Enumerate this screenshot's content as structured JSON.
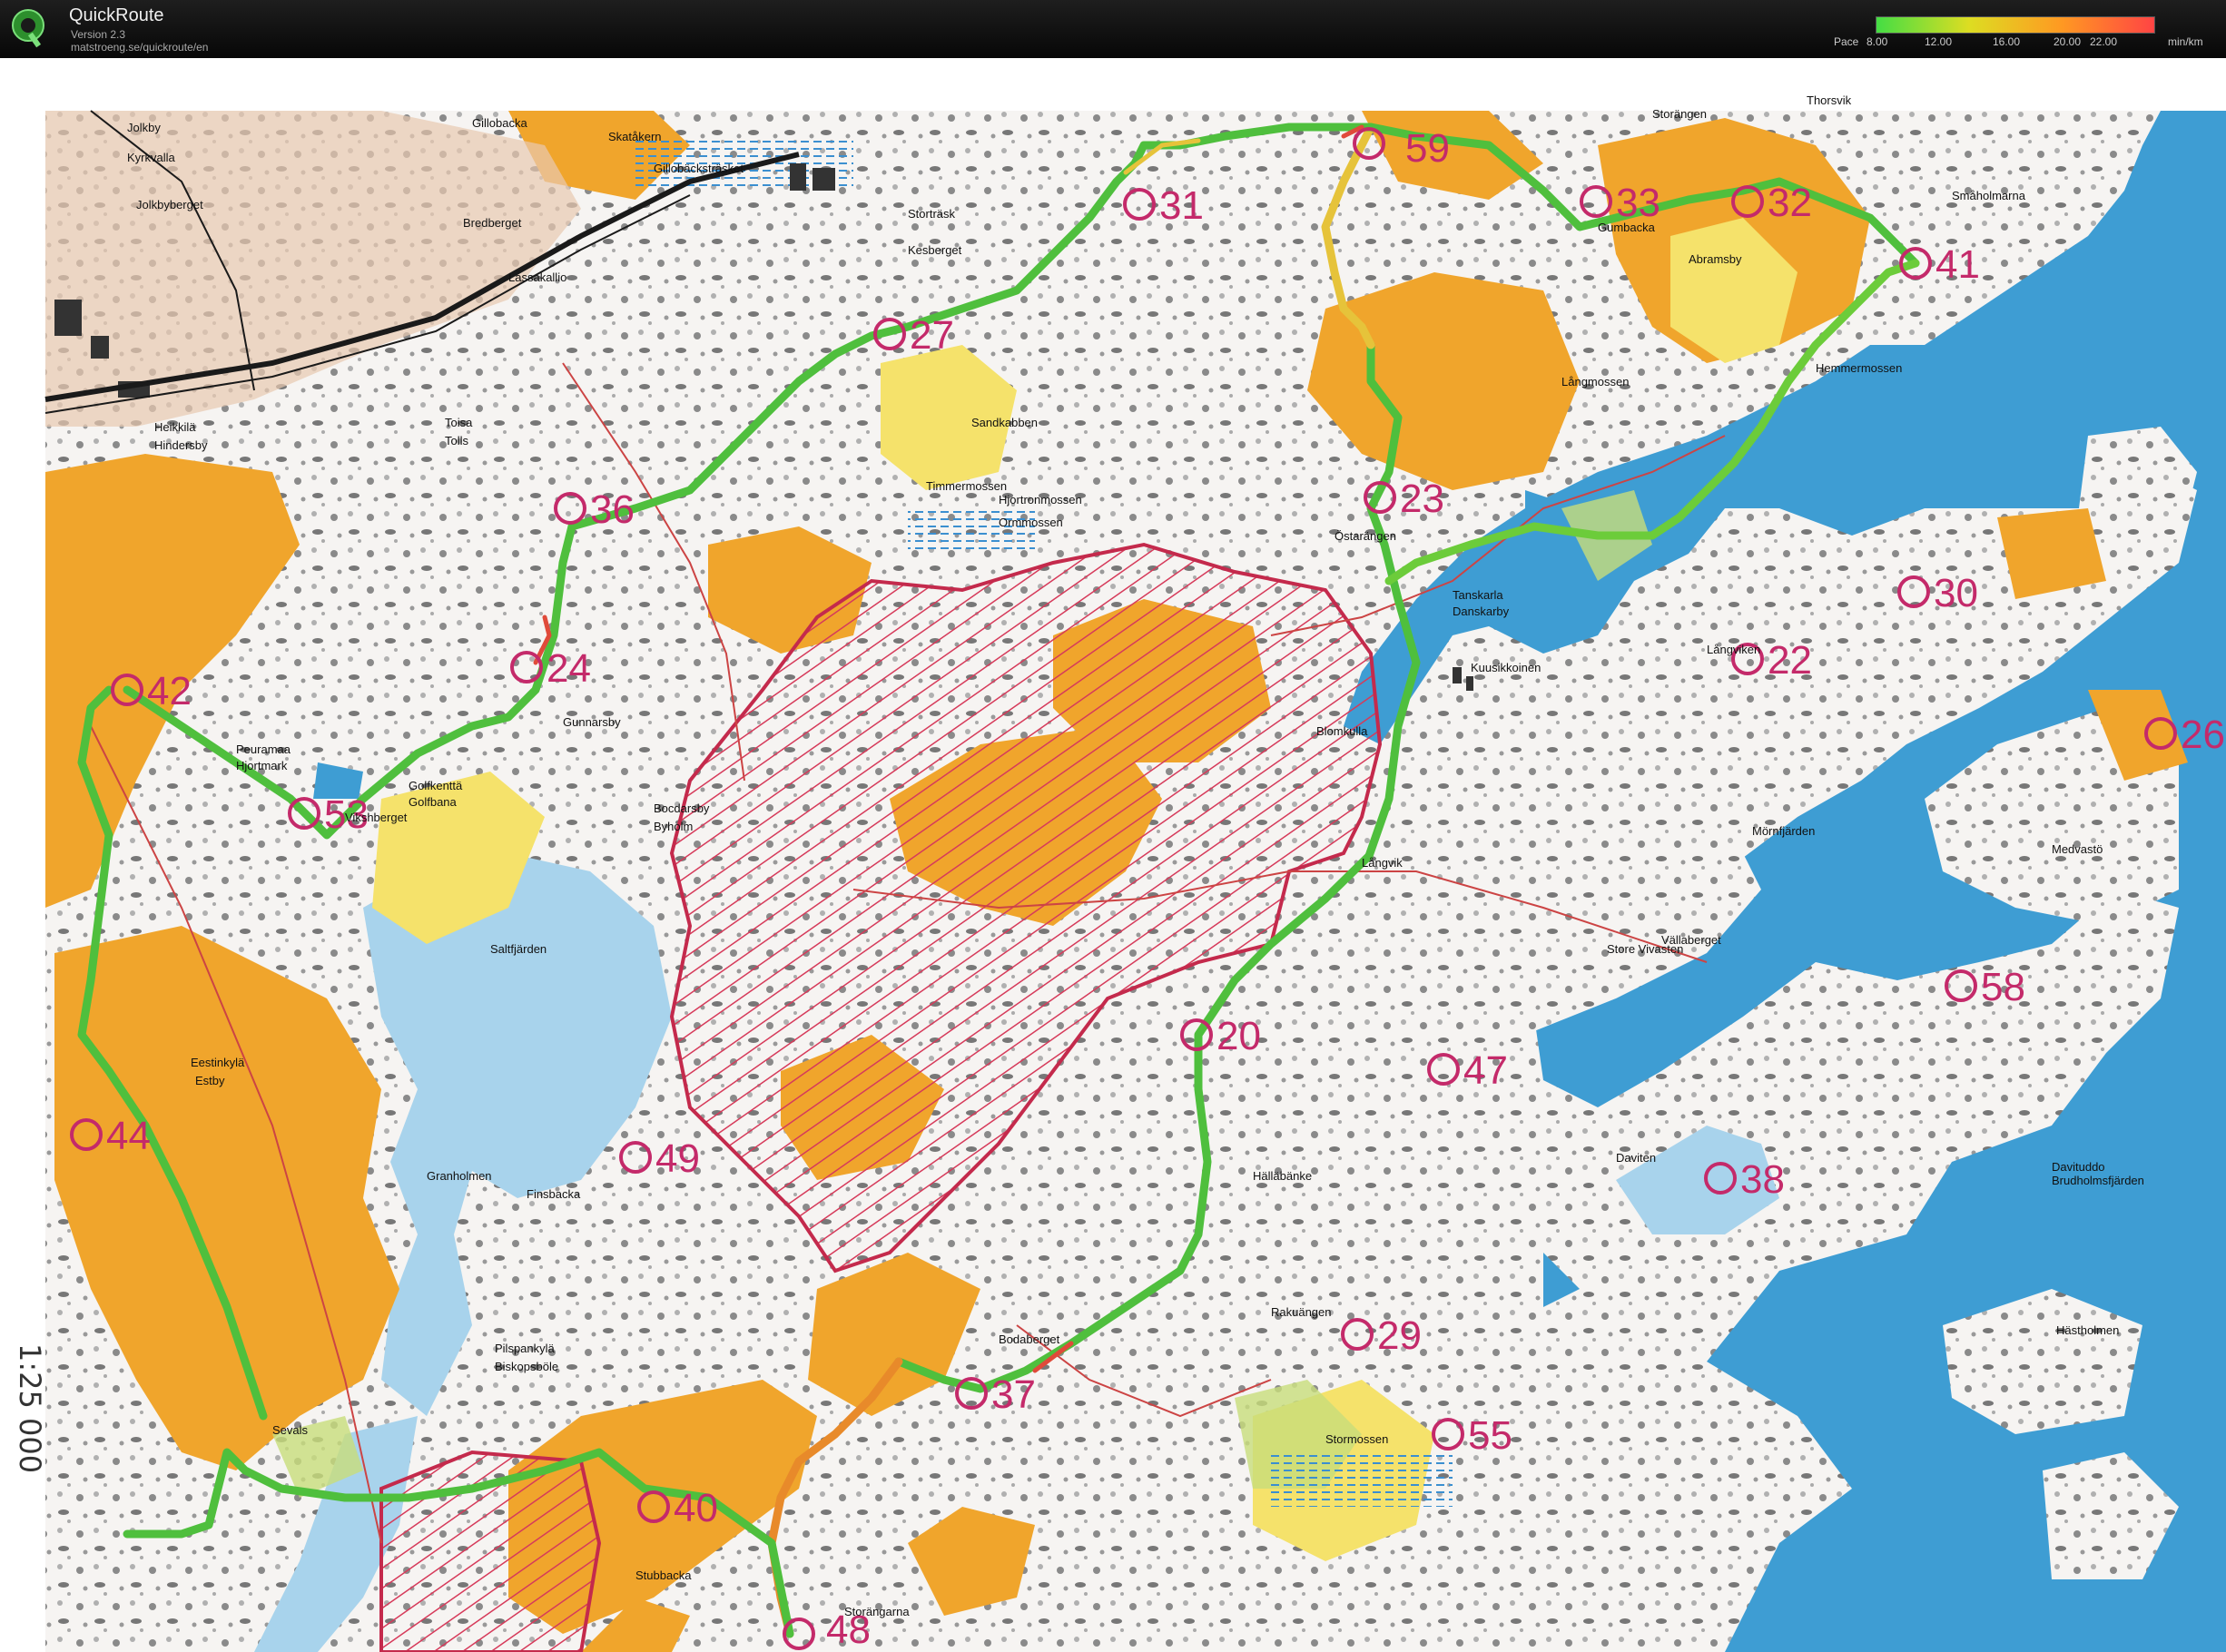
{
  "app": {
    "name": "QuickRoute",
    "version": "Version 2.3",
    "url": "matstroeng.se/quickroute/en"
  },
  "pace_legend": {
    "label": "Pace",
    "ticks": [
      "8.00",
      "12.00",
      "16.00",
      "20.00",
      "22.00"
    ],
    "unit": "min/km",
    "colors": [
      "#44dd44",
      "#dddd22",
      "#ff9922",
      "#ff4444"
    ]
  },
  "map": {
    "scale_note": "1:25 000",
    "controls": [
      {
        "number": "31"
      },
      {
        "number": "33"
      },
      {
        "number": "32"
      },
      {
        "number": "41"
      },
      {
        "number": "27"
      },
      {
        "number": "36"
      },
      {
        "number": "23"
      },
      {
        "number": "30"
      },
      {
        "number": "22"
      },
      {
        "number": "26"
      },
      {
        "number": "42"
      },
      {
        "number": "24"
      },
      {
        "number": "53"
      },
      {
        "number": "20"
      },
      {
        "number": "47"
      },
      {
        "number": "58"
      },
      {
        "number": "44"
      },
      {
        "number": "49"
      },
      {
        "number": "38"
      },
      {
        "number": "29"
      },
      {
        "number": "37"
      },
      {
        "number": "55"
      },
      {
        "number": "40"
      },
      {
        "number": "48"
      },
      {
        "number": "59"
      }
    ],
    "place_names": [
      "Jolkby",
      "Gillobacka",
      "Kyrkvalla",
      "Jolkbyberget",
      "Bredberget",
      "Lassakallio",
      "Heikkilä",
      "Hindersby",
      "Toisa",
      "Tolls",
      "Skatåkern",
      "Gillobäcksträsket",
      "Storängen",
      "Thorsvik",
      "Gumbacka",
      "Abramsby",
      "Långmossen",
      "Hemmermossen",
      "Kesberget",
      "Sandkabben",
      "Timmermossen",
      "Hjortronmossen",
      "Ormmossen",
      "Östarängen",
      "Tanskarla",
      "Danskarby",
      "Långviken",
      "Kuusikkoinen",
      "Blomkulla",
      "Gunnarsby",
      "Golfkenttä",
      "Golfbana",
      "Peuramaa",
      "Hjortmark",
      "Vikshberget",
      "Bocdarsby",
      "Byholm",
      "Saltfjärden",
      "Eestinkylä",
      "Estby",
      "Granholmen",
      "Finsbacka",
      "Mörnfjärden",
      "Medvastö",
      "Store Vivasten",
      "Vällaberget",
      "Daviten",
      "Davituddo",
      "Brudholmsfjärden",
      "Pilspankylä",
      "Biskopsböle",
      "Sevals",
      "Stormossen",
      "Långvik",
      "Hälläbänke",
      "Rakuängen",
      "Bodaberget",
      "Stubbacka",
      "Storängarna",
      "Hästholmen",
      "Småholmarna",
      "Storträsk"
    ]
  }
}
